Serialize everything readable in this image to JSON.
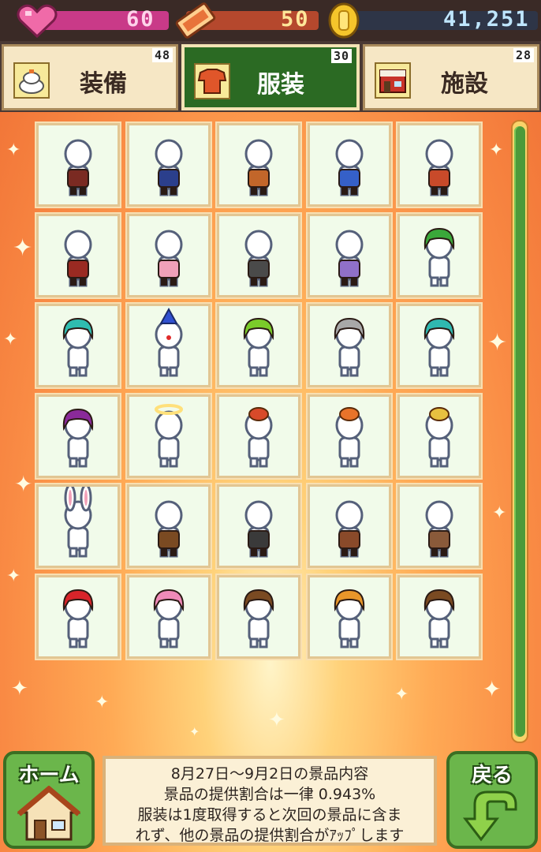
{
  "status": {
    "hearts": "60",
    "tickets": "50",
    "coins": "41,251"
  },
  "tabs": [
    {
      "label": "装備",
      "count": "48",
      "icon": "rice-cake-icon",
      "active": false
    },
    {
      "label": "服装",
      "count": "30",
      "icon": "shirt-icon",
      "active": true
    },
    {
      "label": "施設",
      "count": "28",
      "icon": "shop-icon",
      "active": false
    }
  ],
  "grid": {
    "rows": 6,
    "cols": 5,
    "items": [
      "costume-black-red-outfit",
      "costume-navy-blue-outfit",
      "costume-brown-orange-outfit",
      "costume-blue-swimwear",
      "costume-red-gold-outfit",
      "costume-dark-red-outfit",
      "costume-pink-dress",
      "costume-maid-outfit",
      "costume-purple-dress",
      "costume-green-hair",
      "costume-teal-hair",
      "costume-clown-head",
      "costume-green-hair-red-bow",
      "costume-gray-hair",
      "costume-teal-twin-tails",
      "costume-purple-witch-hair",
      "costume-halo",
      "costume-crown",
      "costume-pumpkin-hat",
      "costume-flower-tiara",
      "costume-bunny-ears",
      "costume-brown-apron-outfit",
      "costume-black-armor",
      "costume-brown-shorts-outfit",
      "costume-brown-vest-outfit",
      "costume-red-spiky-hair",
      "costume-pink-hair",
      "costume-goggles-helmet",
      "costume-orange-cat-hair",
      "costume-brown-goggles-hair"
    ]
  },
  "buttons": {
    "home": "ホーム",
    "back": "戻る"
  },
  "info": {
    "line1": "8月27日～9月2日の景品内容",
    "line2": "景品の提供割合は一律 0.943%",
    "line3": "服装は1度取得すると次回の景品に含ま",
    "line4": "れず、他の景品の提供割合がｱｯﾌﾟします"
  },
  "colors": {
    "active_tab_bg": "#2b6a23",
    "inactive_tab_bg": "#f6e7c5",
    "cell_bg": "#f1fbea",
    "scroll_thumb": "#4c9a3a"
  }
}
